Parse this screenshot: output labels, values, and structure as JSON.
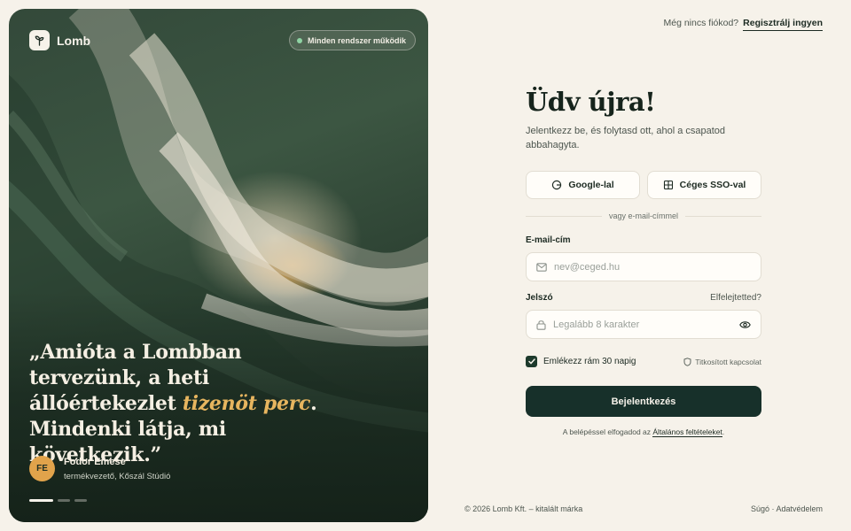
{
  "brand": {
    "name": "Lomb"
  },
  "hero": {
    "status": "Minden rendszer működik",
    "quote": {
      "lead": "„Amióta a Lombban tervezünk, a heti állóértekezlet ",
      "accent": "tizenöt perc",
      "tail": ". Mindenki látja, mi következik.”"
    },
    "author": {
      "initials": "FE",
      "name": "Fodor Emese",
      "role": "termékvezető, Kőszál Stúdió"
    }
  },
  "header": {
    "question": "Még nincs fiókod?",
    "signup_link": "Regisztrálj ingyen"
  },
  "form": {
    "title": "Üdv újra!",
    "subtitle": "Jelentkezz be, és folytasd ott, ahol a csapatod abbahagyta.",
    "google_label": "Google-lal",
    "sso_label": "Céges SSO-val",
    "divider": "vagy e-mail-címmel",
    "email_label": "E-mail-cím",
    "email_placeholder": "nev@ceged.hu",
    "password_label": "Jelszó",
    "forgot_label": "Elfelejtetted?",
    "password_placeholder": "Legalább 8 karakter",
    "remember_label": "Emlékezz rám 30 napig",
    "remember_checked": true,
    "secure_label": "Titkosított kapcsolat",
    "submit_label": "Bejelentkezés",
    "terms_prefix": "A belépéssel elfogadod az ",
    "terms_link": "Általános feltételeket",
    "terms_suffix": "."
  },
  "footer": {
    "copyright": "© 2026 Lomb Kft. – kitalált márka",
    "links": "Súgó · Adatvédelem"
  },
  "colors": {
    "accent": "#17302a",
    "gold": "#e7b55f",
    "background": "#f6f2ea"
  }
}
